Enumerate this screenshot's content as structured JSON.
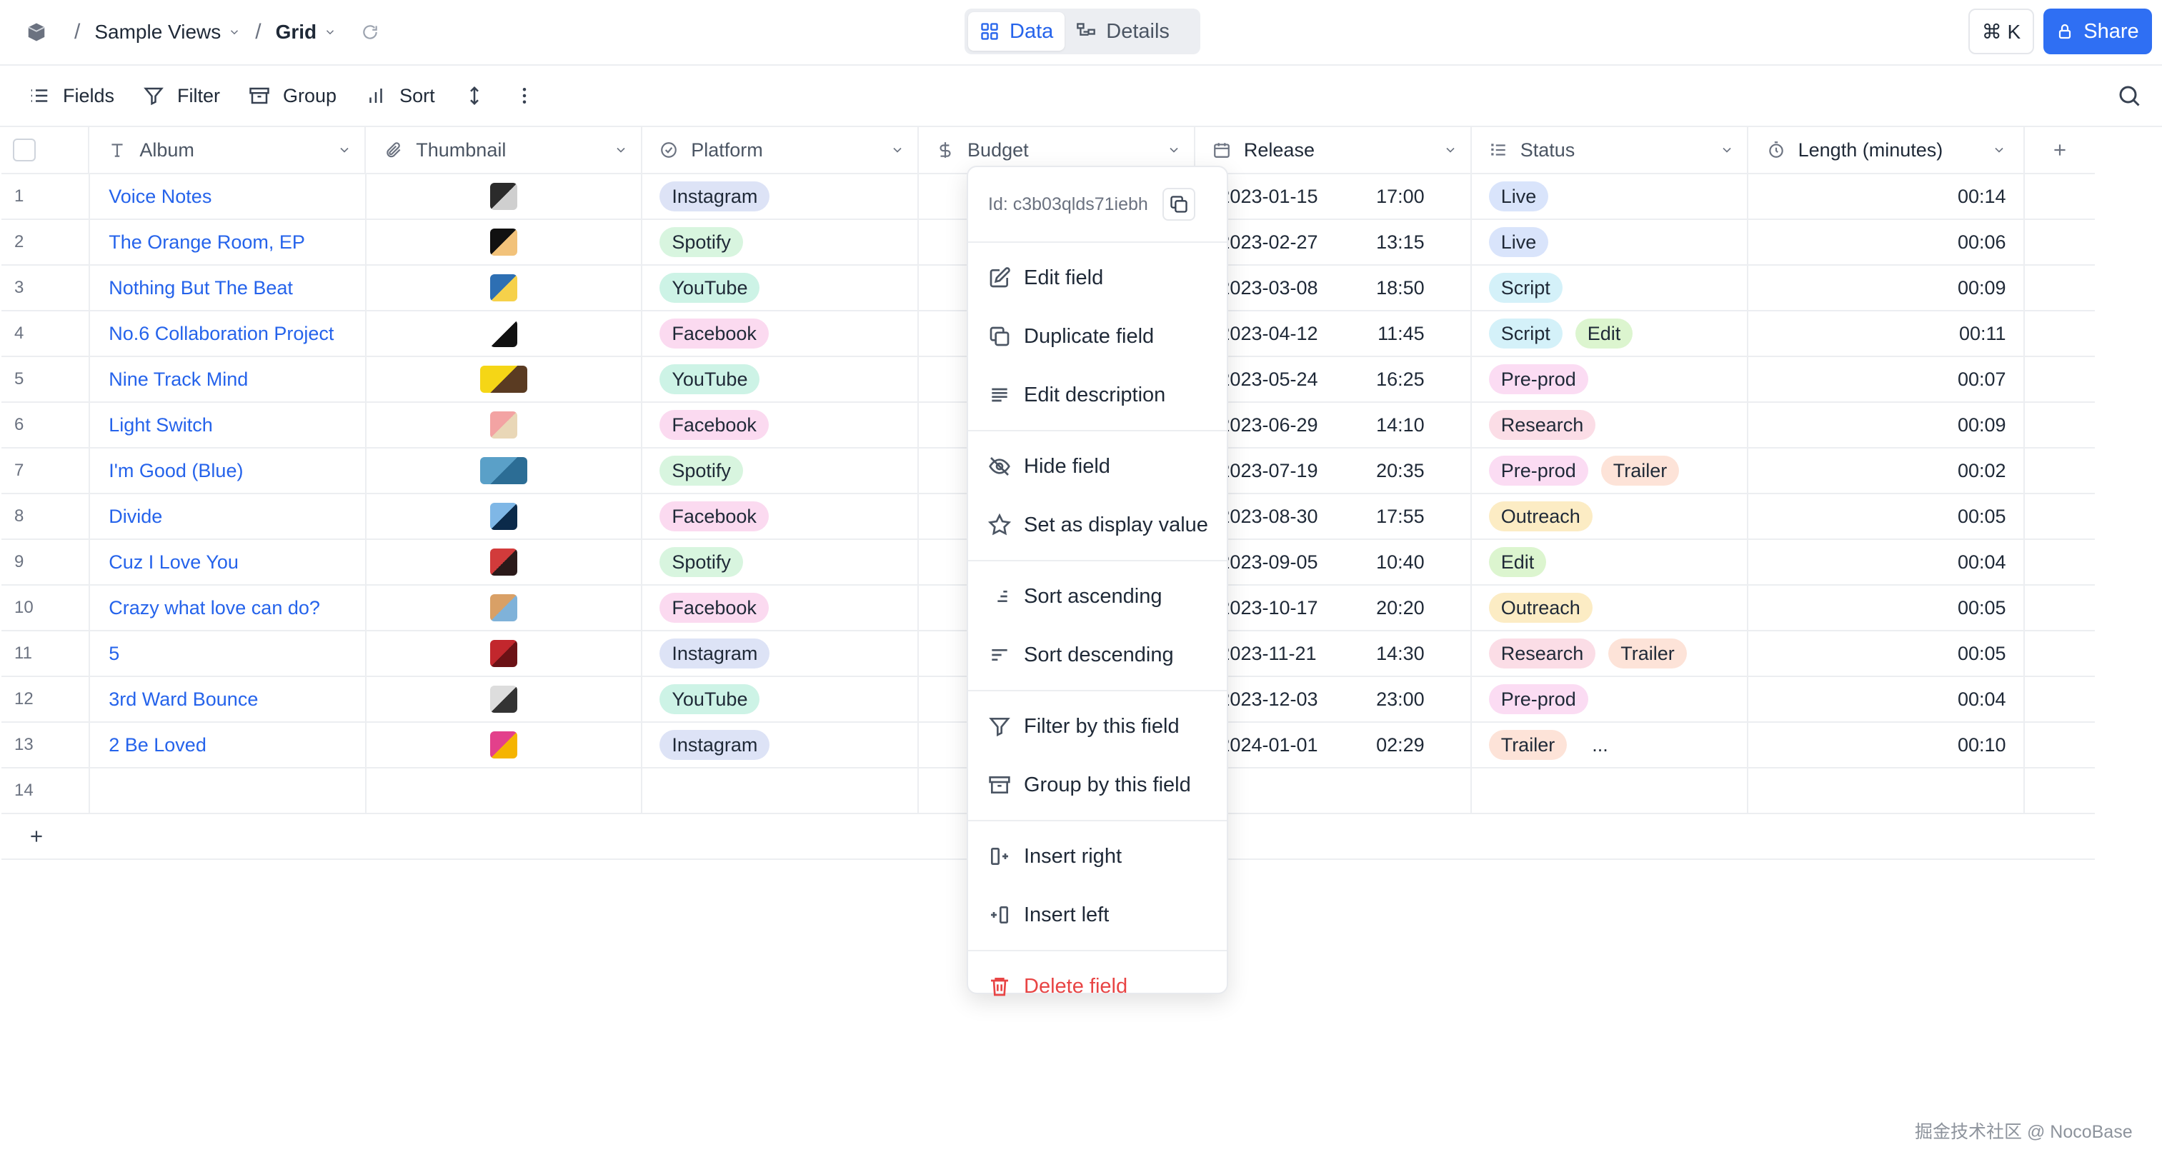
{
  "breadcrumb": {
    "base": "Sample Views",
    "view": "Grid"
  },
  "view_switch": {
    "data_label": "Data",
    "details_label": "Details"
  },
  "topbar": {
    "cmdk_label": "⌘ K",
    "share_label": "Share"
  },
  "toolbar": {
    "fields": "Fields",
    "filter": "Filter",
    "group": "Group",
    "sort": "Sort"
  },
  "columns": [
    {
      "name": "Album",
      "icon": "text-type-icon"
    },
    {
      "name": "Thumbnail",
      "icon": "attachment-icon"
    },
    {
      "name": "Platform",
      "icon": "single-select-icon"
    },
    {
      "name": "Budget",
      "icon": "currency-icon"
    },
    {
      "name": "Release",
      "icon": "calendar-icon"
    },
    {
      "name": "Status",
      "icon": "multi-select-icon"
    },
    {
      "name": "Length (minutes)",
      "icon": "timer-icon"
    }
  ],
  "rows": [
    {
      "n": "1",
      "album": "Voice Notes",
      "thumb": [
        "#2b2b2b",
        "#cfcfcf"
      ],
      "platform": "Instagram",
      "date": "2023-01-15",
      "time": "17:00",
      "status": [
        "Live"
      ],
      "length": "00:14"
    },
    {
      "n": "2",
      "album": "The Orange Room, EP",
      "thumb": [
        "#111111",
        "#f2c27a"
      ],
      "platform": "Spotify",
      "date": "2023-02-27",
      "time": "13:15",
      "status": [
        "Live"
      ],
      "length": "00:06"
    },
    {
      "n": "3",
      "album": "Nothing But The Beat",
      "thumb": [
        "#2d6fb3",
        "#f6d14a"
      ],
      "platform": "YouTube",
      "date": "2023-03-08",
      "time": "18:50",
      "status": [
        "Script"
      ],
      "length": "00:09"
    },
    {
      "n": "4",
      "album": "No.6 Collaboration Project",
      "thumb": [
        "#ffffff",
        "#111111"
      ],
      "platform": "Facebook",
      "date": "2023-04-12",
      "time": "11:45",
      "status": [
        "Script",
        "Edit"
      ],
      "length": "00:11"
    },
    {
      "n": "5",
      "album": "Nine Track Mind",
      "thumb": [
        "#f5d616",
        "#5a3b22"
      ],
      "platform": "YouTube",
      "date": "2023-05-24",
      "time": "16:25",
      "status": [
        "Pre-prod"
      ],
      "length": "00:07"
    },
    {
      "n": "6",
      "album": "Light Switch",
      "thumb": [
        "#f3a3a3",
        "#e9d7b7"
      ],
      "platform": "Facebook",
      "date": "2023-06-29",
      "time": "14:10",
      "status": [
        "Research"
      ],
      "length": "00:09"
    },
    {
      "n": "7",
      "album": "I'm Good (Blue)",
      "thumb": [
        "#5aa0c8",
        "#2c6d95"
      ],
      "platform": "Spotify",
      "date": "2023-07-19",
      "time": "20:35",
      "status": [
        "Pre-prod",
        "Trailer"
      ],
      "length": "00:02"
    },
    {
      "n": "8",
      "album": "Divide",
      "thumb": [
        "#7fb7e6",
        "#0b2a4a"
      ],
      "platform": "Facebook",
      "date": "2023-08-30",
      "time": "17:55",
      "status": [
        "Outreach"
      ],
      "length": "00:05"
    },
    {
      "n": "9",
      "album": "Cuz I Love You",
      "thumb": [
        "#d23b3b",
        "#2b1a1a"
      ],
      "platform": "Spotify",
      "date": "2023-09-05",
      "time": "10:40",
      "status": [
        "Edit"
      ],
      "length": "00:04"
    },
    {
      "n": "10",
      "album": "Crazy what love can do?",
      "thumb": [
        "#d9a066",
        "#7fb2d9"
      ],
      "platform": "Facebook",
      "date": "2023-10-17",
      "time": "20:20",
      "status": [
        "Outreach"
      ],
      "length": "00:05"
    },
    {
      "n": "11",
      "album": "5",
      "thumb": [
        "#c2272d",
        "#6b1216"
      ],
      "platform": "Instagram",
      "date": "2023-11-21",
      "time": "14:30",
      "status": [
        "Research",
        "Trailer"
      ],
      "length": "00:05"
    },
    {
      "n": "12",
      "album": "3rd Ward Bounce",
      "thumb": [
        "#dddddd",
        "#333333"
      ],
      "platform": "YouTube",
      "date": "2023-12-03",
      "time": "23:00",
      "status": [
        "Pre-prod"
      ],
      "length": "00:04"
    },
    {
      "n": "13",
      "album": "2 Be Loved",
      "thumb": [
        "#e3408b",
        "#f5b400"
      ],
      "platform": "Instagram",
      "date": "2024-01-01",
      "time": "02:29",
      "status": [
        "Trailer",
        "..."
      ],
      "length": "00:10"
    },
    {
      "n": "14",
      "album": "",
      "thumb": null,
      "platform": "",
      "date": "",
      "time": "",
      "status": [],
      "length": ""
    }
  ],
  "platform_colors": {
    "Instagram": "#dde3f6",
    "Spotify": "#d8f5df",
    "YouTube": "#cdf3e6",
    "Facebook": "#fbdaf0"
  },
  "status_colors": {
    "Live": "#d9e4fb",
    "Script": "#d4f1f9",
    "Edit": "#dcf5cf",
    "Pre-prod": "#fbdcf3",
    "Research": "#fbdde6",
    "Trailer": "#fde3d8",
    "Outreach": "#fcecc4",
    "...": "transparent"
  },
  "column_menu": {
    "field_id": "Id: c3b03qlds71iebh",
    "groups": [
      [
        {
          "label": "Edit field",
          "icon": "edit-icon"
        },
        {
          "label": "Duplicate field",
          "icon": "copy-icon"
        },
        {
          "label": "Edit description",
          "icon": "description-icon"
        }
      ],
      [
        {
          "label": "Hide field",
          "icon": "eye-off-icon"
        },
        {
          "label": "Set as display value",
          "icon": "star-icon"
        }
      ],
      [
        {
          "label": "Sort ascending",
          "icon": "sort-asc-icon"
        },
        {
          "label": "Sort descending",
          "icon": "sort-desc-icon"
        }
      ],
      [
        {
          "label": "Filter by this field",
          "icon": "filter-icon"
        },
        {
          "label": "Group by this field",
          "icon": "group-icon"
        }
      ],
      [
        {
          "label": "Insert right",
          "icon": "insert-right-icon"
        },
        {
          "label": "Insert left",
          "icon": "insert-left-icon"
        }
      ],
      [
        {
          "label": "Delete field",
          "icon": "trash-icon",
          "danger": true
        }
      ]
    ]
  },
  "watermark": "掘金技术社区 @ NocoBase",
  "accent_color": "#2f6ff3"
}
